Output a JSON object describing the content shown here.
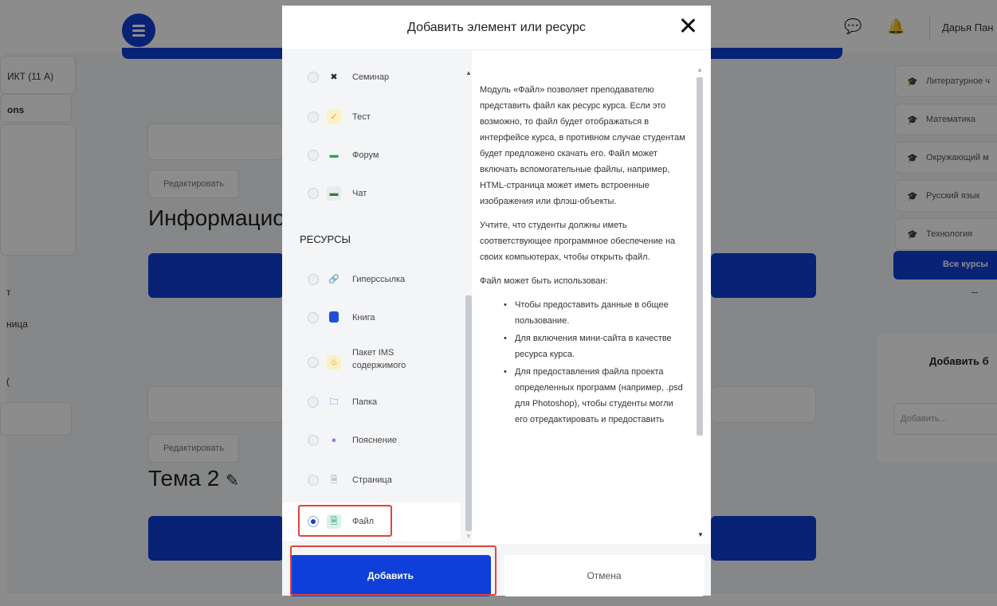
{
  "background": {
    "left_column": {
      "course_fragment": "ИКТ (11 А)",
      "course_sub": "ons",
      "item_1": "т",
      "item_2": "ница",
      "item_3": "("
    },
    "main": {
      "edit_label_1": "Редактировать",
      "heading_1": "Информацио",
      "edit_label_2": "Редактировать",
      "heading_2": "Тема 2"
    },
    "header": {
      "user_name": "Дарья Пан"
    },
    "right_column": {
      "courses": [
        "Литературное ч",
        "Математика",
        "Окружающий м",
        "Русский язык",
        "Технология"
      ],
      "all_courses_label": "Все курсы",
      "dash": "–",
      "add_block_title": "Добавить б",
      "add_block_placeholder": "Добавить..."
    }
  },
  "modal": {
    "title": "Добавить элемент или ресурс",
    "activities": [
      {
        "label": "Семинар",
        "icon": "seminar-icon"
      },
      {
        "label": "Тест",
        "icon": "quiz-icon"
      },
      {
        "label": "Форум",
        "icon": "forum-icon"
      },
      {
        "label": "Чат",
        "icon": "chat-icon"
      }
    ],
    "resources_heading": "РЕСУРСЫ",
    "resources": [
      {
        "label": "Гиперссылка",
        "icon": "link-icon"
      },
      {
        "label": "Книга",
        "icon": "book-icon"
      },
      {
        "label_line1": "Пакет IMS",
        "label_line2": "содержимого",
        "icon": "ims-package-icon"
      },
      {
        "label": "Папка",
        "icon": "folder-icon"
      },
      {
        "label": "Пояснение",
        "icon": "label-icon"
      },
      {
        "label": "Страница",
        "icon": "page-icon"
      },
      {
        "label": "Файл",
        "icon": "file-icon",
        "selected": true
      }
    ],
    "description": {
      "p1": "Модуль «Файл» позволяет преподавателю представить файл как ресурс курса. Если это возможно, то файл будет отображаться в интерфейсе курса, в противном случае студентам будет предложено скачать его. Файл может включать вспомогательные файлы, например, HTML-страница может иметь встроенные изображения или флэш-объекты.",
      "p2": "Учтите, что студенты должны иметь соответствующее программное обеспечение на своих компьютерах, чтобы открыть файл.",
      "p3": "Файл может быть использован:",
      "bullets": [
        "Чтобы предоставить данные в общее пользование.",
        "Для включения мини-сайта в качестве ресурса курса.",
        "Для предоставления файла проекта определенных программ (например, .psd для Photoshop), чтобы студенты могли его отредактировать и предоставить"
      ]
    },
    "buttons": {
      "add": "Добавить",
      "cancel": "Отмена"
    }
  },
  "colors": {
    "accent": "#0f3fd8",
    "highlight": "#e0443b"
  }
}
